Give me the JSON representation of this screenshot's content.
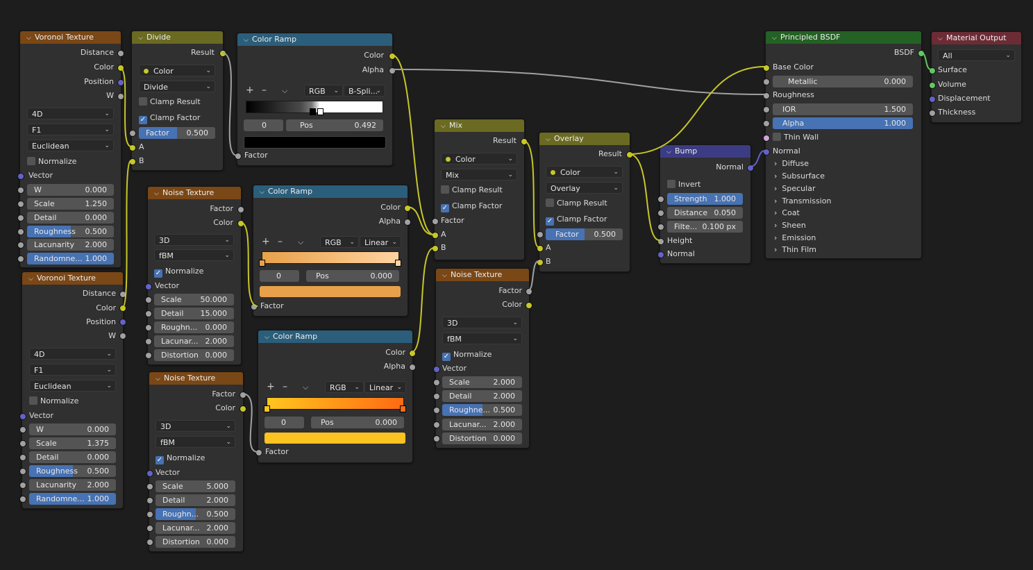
{
  "voronoi1": {
    "title": "Voronoi Texture",
    "outputs": [
      "Distance",
      "Color",
      "Position",
      "W"
    ],
    "dims": "4D",
    "feature": "F1",
    "metric": "Euclidean",
    "normalize": "Normalize",
    "vector": "Vector",
    "fields": [
      {
        "label": "W",
        "value": "0.000"
      },
      {
        "label": "Scale",
        "value": "1.250"
      },
      {
        "label": "Detail",
        "value": "0.000"
      },
      {
        "label": "Roughness",
        "value": "0.500"
      },
      {
        "label": "Lacunarity",
        "value": "2.000"
      },
      {
        "label": "Randomne...",
        "value": "1.000"
      }
    ]
  },
  "voronoi2": {
    "title": "Voronoi Texture",
    "outputs": [
      "Distance",
      "Color",
      "Position",
      "W"
    ],
    "dims": "4D",
    "feature": "F1",
    "metric": "Euclidean",
    "normalize": "Normalize",
    "vector": "Vector",
    "fields": [
      {
        "label": "W",
        "value": "0.000"
      },
      {
        "label": "Scale",
        "value": "1.375"
      },
      {
        "label": "Detail",
        "value": "0.000"
      },
      {
        "label": "Roughness",
        "value": "0.500"
      },
      {
        "label": "Lacunarity",
        "value": "2.000"
      },
      {
        "label": "Randomne...",
        "value": "1.000"
      }
    ]
  },
  "divide": {
    "title": "Divide",
    "result": "Result",
    "type": "Color",
    "op": "Divide",
    "clamp_result": "Clamp Result",
    "clamp_factor": "Clamp Factor",
    "factor_label": "Factor",
    "factor_value": "0.500",
    "a": "A",
    "b": "B"
  },
  "ramp1": {
    "title": "Color Ramp",
    "out_color": "Color",
    "out_alpha": "Alpha",
    "mode": "RGB",
    "interp": "B-Spli...",
    "index": "0",
    "pos_label": "Pos",
    "pos_value": "0.492",
    "factor": "Factor"
  },
  "ramp2": {
    "title": "Color Ramp",
    "out_color": "Color",
    "out_alpha": "Alpha",
    "mode": "RGB",
    "interp": "Linear",
    "index": "0",
    "pos_label": "Pos",
    "pos_value": "0.000",
    "factor": "Factor"
  },
  "ramp3": {
    "title": "Color Ramp",
    "out_color": "Color",
    "out_alpha": "Alpha",
    "mode": "RGB",
    "interp": "Linear",
    "index": "0",
    "pos_label": "Pos",
    "pos_value": "0.000",
    "factor": "Factor"
  },
  "noise1": {
    "title": "Noise Texture",
    "outputs": [
      "Factor",
      "Color"
    ],
    "dims": "3D",
    "type": "fBM",
    "normalize": "Normalize",
    "vector": "Vector",
    "fields": [
      {
        "label": "Scale",
        "value": "50.000"
      },
      {
        "label": "Detail",
        "value": "15.000"
      },
      {
        "label": "Roughn...",
        "value": "0.000"
      },
      {
        "label": "Lacunar...",
        "value": "2.000"
      },
      {
        "label": "Distortion",
        "value": "0.000"
      }
    ]
  },
  "noise2": {
    "title": "Noise Texture",
    "outputs": [
      "Factor",
      "Color"
    ],
    "dims": "3D",
    "type": "fBM",
    "normalize": "Normalize",
    "vector": "Vector",
    "fields": [
      {
        "label": "Scale",
        "value": "5.000"
      },
      {
        "label": "Detail",
        "value": "2.000"
      },
      {
        "label": "Roughn...",
        "value": "0.500"
      },
      {
        "label": "Lacunar...",
        "value": "2.000"
      },
      {
        "label": "Distortion",
        "value": "0.000"
      }
    ]
  },
  "noise3": {
    "title": "Noise Texture",
    "outputs": [
      "Factor",
      "Color"
    ],
    "dims": "3D",
    "type": "fBM",
    "normalize": "Normalize",
    "vector": "Vector",
    "fields": [
      {
        "label": "Scale",
        "value": "2.000"
      },
      {
        "label": "Detail",
        "value": "2.000"
      },
      {
        "label": "Roughne...",
        "value": "0.500"
      },
      {
        "label": "Lacunar...",
        "value": "2.000"
      },
      {
        "label": "Distortion",
        "value": "0.000"
      }
    ]
  },
  "mix": {
    "title": "Mix",
    "result": "Result",
    "type": "Color",
    "blend": "Mix",
    "clamp_result": "Clamp Result",
    "clamp_factor": "Clamp Factor",
    "factor": "Factor",
    "a": "A",
    "b": "B"
  },
  "overlay": {
    "title": "Overlay",
    "result": "Result",
    "type": "Color",
    "blend": "Overlay",
    "clamp_result": "Clamp Result",
    "clamp_factor": "Clamp Factor",
    "factor_label": "Factor",
    "factor_value": "0.500",
    "a": "A",
    "b": "B"
  },
  "bump": {
    "title": "Bump",
    "out_normal": "Normal",
    "invert": "Invert",
    "strength_label": "Strength",
    "strength_value": "1.000",
    "distance_label": "Distance",
    "distance_value": "0.050",
    "filter_label": "Filte...",
    "filter_value": "0.100 px",
    "height": "Height",
    "normal": "Normal"
  },
  "bsdf": {
    "title": "Principled BSDF",
    "out": "BSDF",
    "base_color": "Base Color",
    "metallic_label": "Metallic",
    "metallic_value": "0.000",
    "roughness": "Roughness",
    "ior_label": "IOR",
    "ior_value": "1.500",
    "alpha_label": "Alpha",
    "alpha_value": "1.000",
    "thin_wall": "Thin Wall",
    "normal": "Normal",
    "panels": [
      "Diffuse",
      "Subsurface",
      "Specular",
      "Transmission",
      "Coat",
      "Sheen",
      "Emission",
      "Thin Film"
    ]
  },
  "output": {
    "title": "Material Output",
    "target": "All",
    "inputs": [
      "Surface",
      "Volume",
      "Displacement",
      "Thickness"
    ]
  },
  "colors": {
    "texture_header": "#7a4716",
    "converter_header": "#2b5e7a",
    "color_header": "#6a6a22",
    "shader_header": "#246124",
    "vector_header": "#3c3c85",
    "output_header": "#6d2c35",
    "socket_color": "#c7c729",
    "socket_float": "#a1a1a1",
    "socket_vector": "#6363c7",
    "socket_shader": "#63c763",
    "wire_color": "#c7c729",
    "wire_float": "#a1a1a1"
  }
}
